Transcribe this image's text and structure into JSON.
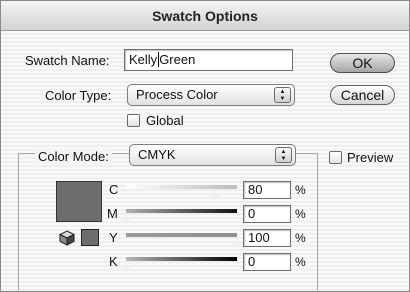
{
  "window": {
    "title": "Swatch Options"
  },
  "swatch_name": {
    "label": "Swatch Name:",
    "value_before_caret": "Kelly",
    "value_after_caret": "Green"
  },
  "color_type": {
    "label": "Color Type:",
    "selected": "Process Color"
  },
  "global": {
    "label": "Global",
    "checked": false
  },
  "color_mode": {
    "label": "Color Mode:",
    "selected": "CMYK"
  },
  "preview": {
    "label": "Preview",
    "checked": false
  },
  "buttons": {
    "ok": "OK",
    "cancel": "Cancel"
  },
  "swatch_color": "#6d6d6d",
  "icons": {
    "gamut": "cube-icon",
    "popup_arrows": "up-down-arrows-icon"
  },
  "channels": [
    {
      "name": "C",
      "value": "80",
      "unit": "%",
      "level": 0.8
    },
    {
      "name": "M",
      "value": "0",
      "unit": "%",
      "level": 0.0
    },
    {
      "name": "Y",
      "value": "100",
      "unit": "%",
      "level": 1.0
    },
    {
      "name": "K",
      "value": "0",
      "unit": "%",
      "level": 0.0
    }
  ]
}
